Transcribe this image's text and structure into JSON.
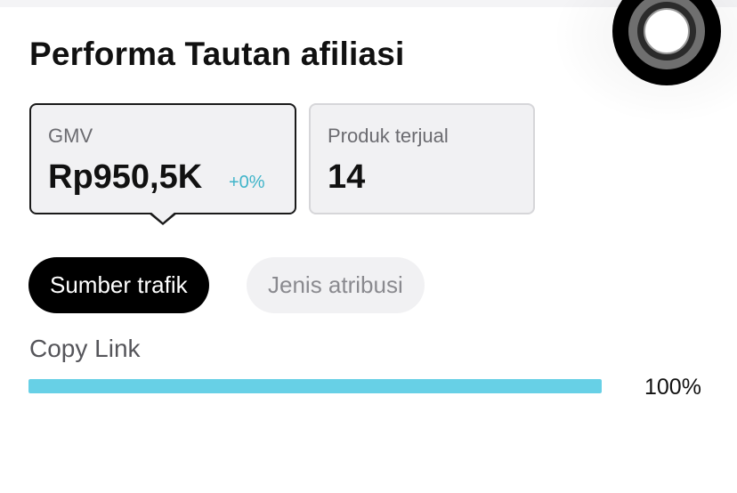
{
  "header": {
    "title": "Performa Tautan afiliasi"
  },
  "metrics": [
    {
      "label": "GMV",
      "value": "Rp950,5K",
      "delta": "+0%",
      "selected": true
    },
    {
      "label": "Produk terjual",
      "value": "14",
      "selected": false
    }
  ],
  "tabs": [
    {
      "label": "Sumber trafik",
      "active": true
    },
    {
      "label": "Jenis atribusi",
      "active": false
    }
  ],
  "traffic_sources": [
    {
      "label": "Copy Link",
      "percent_text": "100%",
      "fraction": 1.0
    }
  ],
  "colors": {
    "accent_bar": "#67d0e6",
    "delta_text": "#3fb4c9",
    "active_tab_bg": "#000000",
    "card_bg": "#f1f1f3"
  },
  "icons": {
    "floating_button": "record-button-icon"
  }
}
